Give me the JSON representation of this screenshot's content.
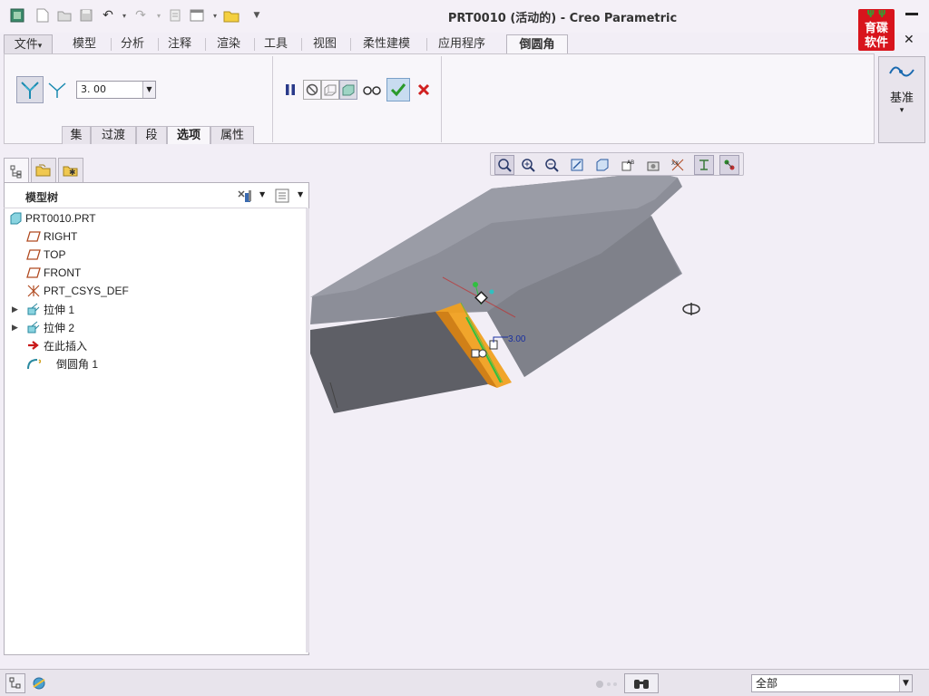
{
  "window": {
    "title": "PRT0010 (活动的) - Creo Parametric",
    "logo_text_line1": "育碟",
    "logo_text_line2": "软件"
  },
  "quick_access": [
    "app-icon",
    "new-icon",
    "open-icon",
    "save-icon",
    "undo-icon",
    "redo-icon",
    "regenerate-icon",
    "windows-icon",
    "close-window-icon",
    "customize-icon"
  ],
  "ribbon": {
    "tabs": [
      {
        "label": "文件",
        "dropdown": "▾"
      },
      {
        "label": "模型"
      },
      {
        "label": "分析"
      },
      {
        "label": "注释"
      },
      {
        "label": "渲染"
      },
      {
        "label": "工具"
      },
      {
        "label": "视图"
      },
      {
        "label": "柔性建模"
      },
      {
        "label": "应用程序"
      },
      {
        "label": "倒圆角"
      }
    ],
    "active_tab": "倒圆角",
    "radius_value": "3. 00",
    "subtabs": [
      "集",
      "过渡",
      "段",
      "选项",
      "属性"
    ],
    "active_subtab": "选项",
    "datum_label": "基准",
    "datum_arrow": "▾"
  },
  "model_tree": {
    "title": "模型树",
    "items": [
      {
        "label": "PRT0010.PRT",
        "icon": "part-icon",
        "expandable": false
      },
      {
        "label": "RIGHT",
        "icon": "datum-plane-icon",
        "expandable": false
      },
      {
        "label": "TOP",
        "icon": "datum-plane-icon",
        "expandable": false
      },
      {
        "label": "FRONT",
        "icon": "datum-plane-icon",
        "expandable": false
      },
      {
        "label": "PRT_CSYS_DEF",
        "icon": "csys-icon",
        "expandable": false
      },
      {
        "label": "拉伸 1",
        "icon": "extrude-icon",
        "expandable": true
      },
      {
        "label": "拉伸 2",
        "icon": "extrude-icon",
        "expandable": true
      },
      {
        "label": "在此插入",
        "icon": "insert-here-icon",
        "expandable": false
      },
      {
        "label": "倒圆角 1",
        "icon": "round-icon",
        "expandable": false
      }
    ]
  },
  "graphics": {
    "dimension_label": "3.00"
  },
  "status": {
    "filter_value": "全部"
  },
  "colors": {
    "accent_orange": "#f0a020",
    "model_gray": "#8a8c94",
    "confirm_green": "#2a9a2a",
    "cancel_red": "#d02020"
  }
}
